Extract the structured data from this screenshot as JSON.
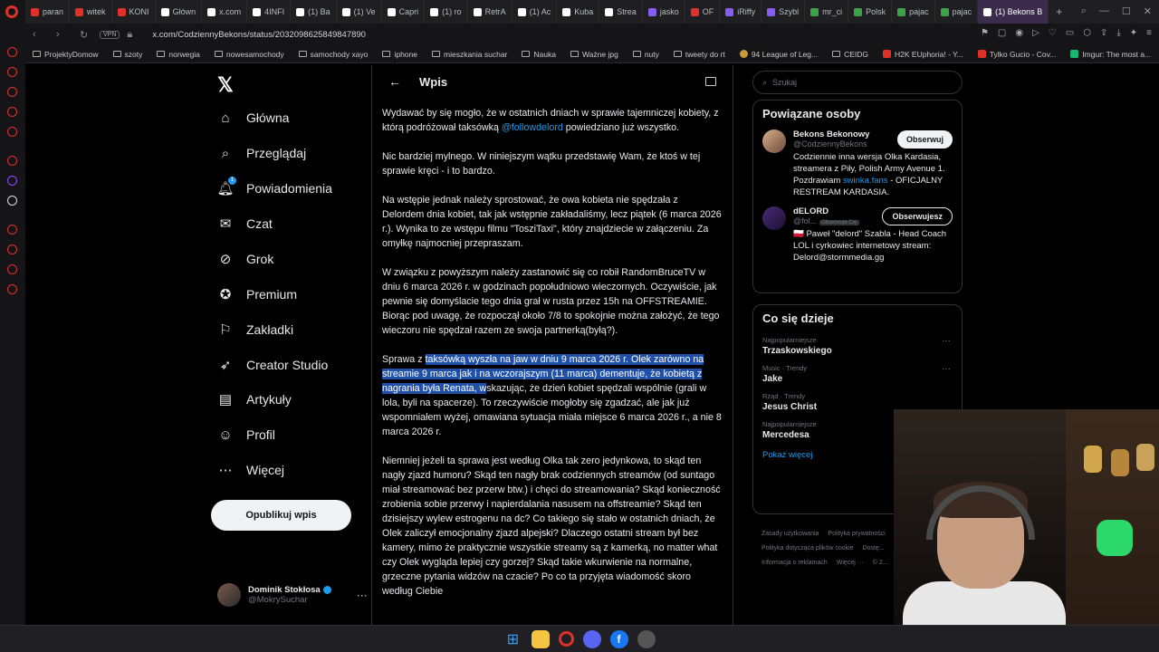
{
  "browser": {
    "tabs": [
      "paran",
      "witek",
      "KONI",
      "Główn",
      "x.com",
      "4INFI",
      "(1) Ba",
      "(1) Ve",
      "Capri",
      "(1) ro",
      "RetrA",
      "(1) Ac",
      "Kuba",
      "Strea",
      "jasko",
      "OF",
      "iRiffy",
      "Szybl",
      "mr_ci",
      "Polsk",
      "pajac",
      "pajac",
      "(1) Bekons B"
    ],
    "url": "x.com/CodziennyBekons/status/2032098625849847890",
    "vpn": "VPN",
    "bookmarks": [
      "ProjektyDomow",
      "szoty",
      "norwegia",
      "nowesamochody",
      "samochody xayo",
      "iphone",
      "mieszkania suchar",
      "Nauka",
      "Ważne jpg",
      "nuty",
      "tweety do rt",
      "94 League of Leg...",
      "CEIDG",
      "H2K EUphoria! - Y...",
      "Tylko Gucio - Cov...",
      "Imgur: The most a..."
    ]
  },
  "nav": {
    "items": [
      {
        "label": "Główna",
        "icon": "home-icon"
      },
      {
        "label": "Przeglądaj",
        "icon": "search-icon"
      },
      {
        "label": "Powiadomienia",
        "icon": "bell-icon"
      },
      {
        "label": "Czat",
        "icon": "mail-icon"
      },
      {
        "label": "Grok",
        "icon": "grok-icon"
      },
      {
        "label": "Premium",
        "icon": "premium-icon"
      },
      {
        "label": "Zakładki",
        "icon": "bookmark-icon"
      },
      {
        "label": "Creator Studio",
        "icon": "rocket-icon"
      },
      {
        "label": "Artykuły",
        "icon": "article-icon"
      },
      {
        "label": "Profil",
        "icon": "person-icon"
      },
      {
        "label": "Więcej",
        "icon": "more-icon"
      }
    ],
    "notif_count": "1",
    "post_button": "Opublikuj wpis",
    "account": {
      "name": "Dominik Stokłosa",
      "handle": "@MokrySuchar"
    }
  },
  "post": {
    "header": "Wpis",
    "p1_a": "Wydawać by się mogło, że w ostatnich dniach w sprawie tajemniczej kobiety, z którą podróżował taksówką ",
    "p1_mention": "@followdelord",
    "p1_b": " powiedziano już wszystko.",
    "p2": "Nic bardziej mylnego. W niniejszym wątku przedstawię Wam, że ktoś w tej sprawie kręci - i to bardzo.",
    "p3": "Na wstępie jednak należy sprostować, że owa kobieta nie spędzała z Delordem dnia kobiet, tak jak wstępnie zakładaliśmy, lecz piątek (6 marca 2026 r.). Wynika to ze wstępu filmu \"TosziTaxi\", który znajdziecie w załączeniu. Za omyłkę najmocniej przepraszam.",
    "p4": "W związku z powyższym należy zastanowić się co robił RandomBruceTV w dniu 6 marca 2026 r. w godzinach popołudniowo wieczornych. Oczywiście, jak pewnie się domyślacie tego dnia grał w rusta przez 15h na OFFSTREAMIE. Biorąc pod uwagę, że rozpoczął około 7/8 to spokojnie można założyć, że tego wieczoru nie spędzał razem ze swoja partnerką(byłą?).",
    "p5_a": "Sprawa z ",
    "p5_sel": "taksówką wyszła na jaw w dniu 9 marca 2026 r. Olek zarówno na streamie 9 marca jak i na wczorajszym (11 marca) dementuje, że kobietą z nagrania była Renata, w",
    "p5_b": "skazując, że dzień kobiet spędzali wspólnie (grali w lola, byli na spacerze). To rzeczywiście mogłoby się zgadzać, ale jak już wspomniałem wyżej, omawiana sytuacja miała miejsce 6 marca 2026 r., a nie 8 marca 2026 r.",
    "p6": "Niemniej jeżeli ta sprawa jest według Olka tak zero jedynkowa, to skąd ten nagły zjazd humoru? Skąd ten nagły brak codziennych streamów (od suntago miał streamować bez przerw btw.) i chęci do streamowania? Skąd konieczność zrobienia sobie przerwy i napierdalania nasusem na offstreamie? Skąd ten dzisiejszy wylew estrogenu na dc? Co takiego się stało w ostatnich dniach, że Olek zaliczył emocjonalny zjazd alpejski? Dlaczego ostatni stream był bez kamery, mimo że praktycznie wszystkie streamy są z kamerką, no matter what czy Olek wygląda lepiej czy gorzej? Skąd takie wkurwienie na normalne, grzeczne pytania widzów na czacie? Po co ta przyjęta wiadomość skoro według Ciebie"
  },
  "sidebar": {
    "search_placeholder": "Szukaj",
    "related_title": "Powiązane osoby",
    "people": [
      {
        "name": "Bekons Bekonowy",
        "handle": "@CodziennyBekons",
        "button": "Obserwuj",
        "bio_a": "Codziennie inna wersja Olka Kardasia, streamera z Piły, Polish Army Avenue 1. Pozdrawiam ",
        "bio_link": "swinka.fans",
        "bio_b": " - OFICJALNY RESTREAM KARDASIA."
      },
      {
        "name": "dELORD",
        "handle": "@fol...",
        "badge": "Obserwuje Cię",
        "button": "Obserwujesz",
        "bio_a": "🇵🇱 Paweł \"delord\" Szabla - Head Coach LOL i cyrkowiec internetowy stream: Delord@stormmedia.gg",
        "bio_link": "",
        "bio_b": ""
      }
    ],
    "trends_title": "Co się dzieje",
    "trends": [
      {
        "context": "Najpopularniejsze",
        "name": "Trzaskowskiego"
      },
      {
        "context": "Music · Trendy",
        "name": "Jake"
      },
      {
        "context": "Rząd · Trendy",
        "name": "Jesus Christ"
      },
      {
        "context": "Najpopularniejsze",
        "name": "Mercedesa"
      }
    ],
    "show_more": "Pokaż więcej",
    "footer": [
      "Zasady użytkowania",
      "Polityka prywatności",
      "Polityka dotycząca plików cookie",
      "Dostę...",
      "Informacja o reklamach",
      "Więcej ···",
      "© 2..."
    ]
  }
}
